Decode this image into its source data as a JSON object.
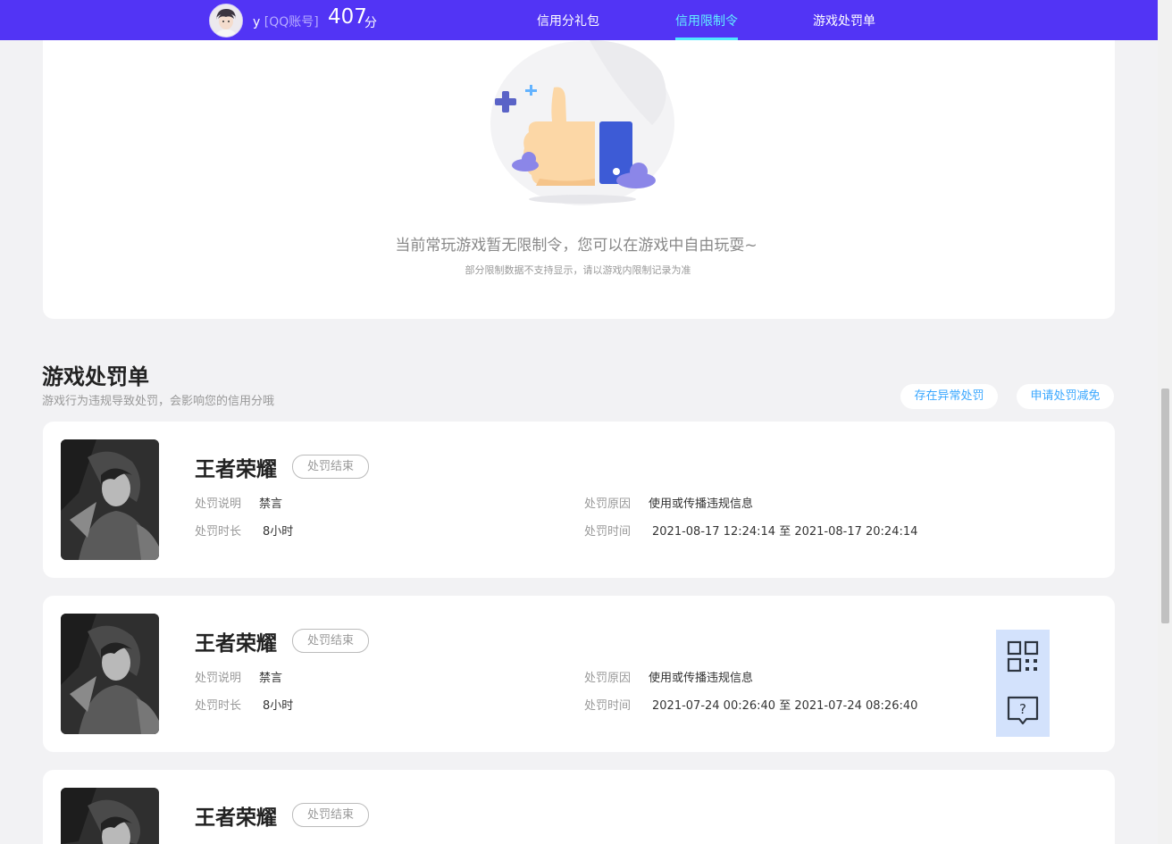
{
  "header": {
    "user_name": "y",
    "account_type": "[QQ账号]",
    "score": "407",
    "score_unit": "分",
    "nav": [
      {
        "label": "信用分礼包",
        "active": false
      },
      {
        "label": "信用限制令",
        "active": true
      },
      {
        "label": "游戏处罚单",
        "active": false
      }
    ],
    "accent_color": "#5234f5",
    "active_color": "#62f0ff"
  },
  "restriction_panel": {
    "empty_message": "当前常玩游戏暂无限制令，您可以在游戏中自由玩耍~",
    "note": "部分限制数据不支持显示，请以游戏内限制记录为准",
    "illustration": "thumbs-up-icon"
  },
  "penalty_section": {
    "title": "游戏处罚单",
    "subtitle": "游戏行为违规导致处罚，会影响您的信用分哦",
    "abnormal_button": "存在异常处罚",
    "reduce_button": "申请处罚减免"
  },
  "penalties": [
    {
      "game": "王者荣耀",
      "status": "处罚结束",
      "desc_label": "处罚说明",
      "desc_value": "禁言",
      "duration_label": "处罚时长",
      "duration_value": "8小时",
      "reason_label": "处罚原因",
      "reason_value": "使用或传播违规信息",
      "time_label": "处罚时间",
      "time_value": "2021-08-17 12:24:14 至 2021-08-17 20:24:14"
    },
    {
      "game": "王者荣耀",
      "status": "处罚结束",
      "desc_label": "处罚说明",
      "desc_value": "禁言",
      "duration_label": "处罚时长",
      "duration_value": "8小时",
      "reason_label": "处罚原因",
      "reason_value": "使用或传播违规信息",
      "time_label": "处罚时间",
      "time_value": "2021-07-24 00:26:40 至 2021-07-24 08:26:40"
    },
    {
      "game": "王者荣耀",
      "status": "处罚结束"
    }
  ],
  "floating": {
    "qr_icon": "qr-code-icon",
    "help_icon": "help-chat-icon"
  }
}
